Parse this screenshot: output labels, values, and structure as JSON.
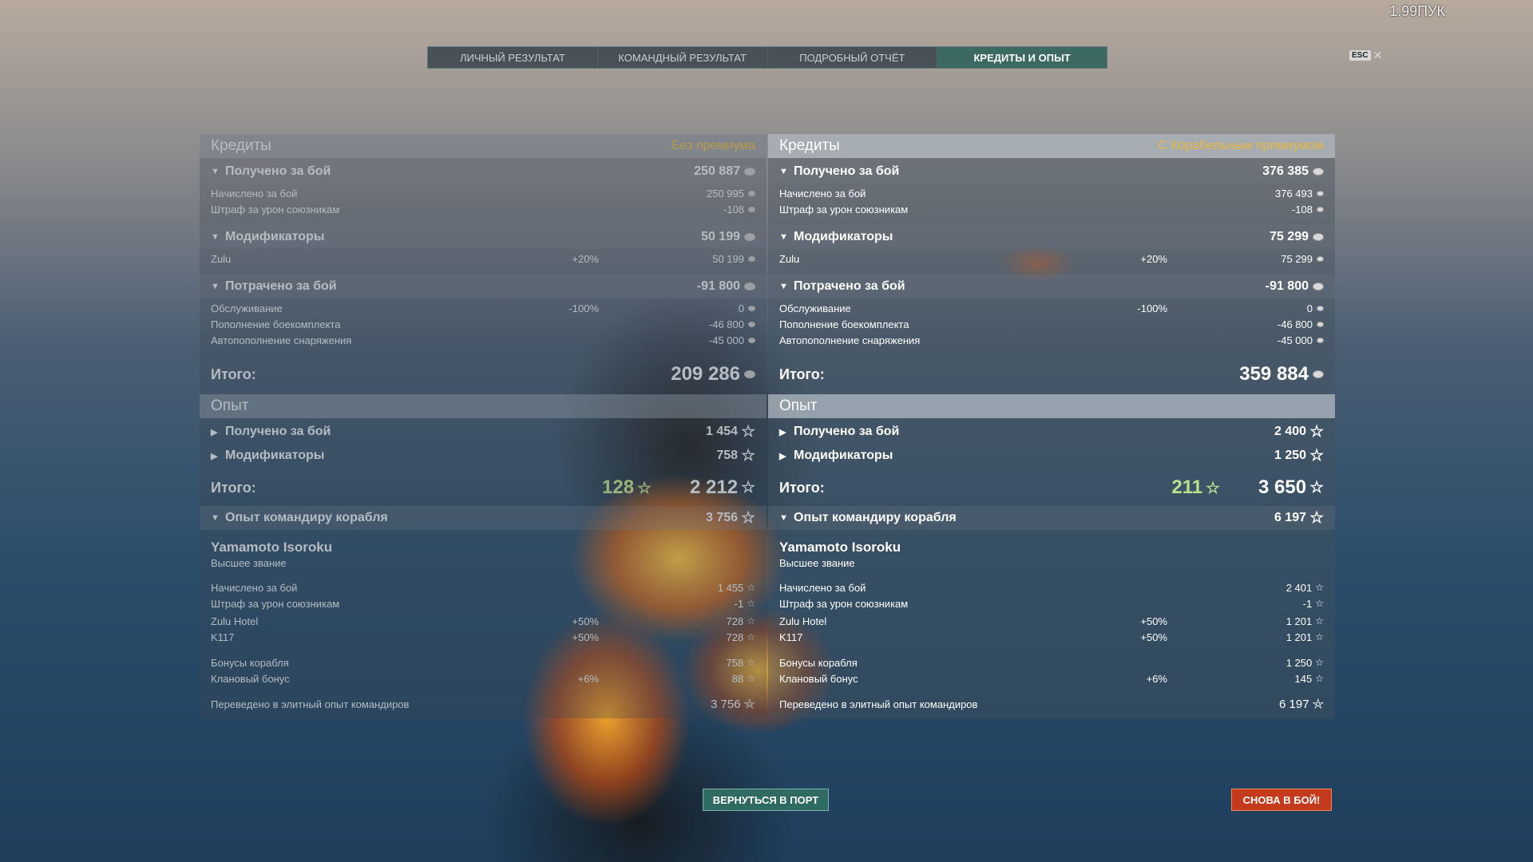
{
  "fps": "1.99ПУК",
  "tabs": [
    "ЛИЧНЫЙ РЕЗУЛЬТАТ",
    "КОМАНДНЫЙ РЕЗУЛЬТАТ",
    "ПОДРОБНЫЙ ОТЧЁТ",
    "КРЕДИТЫ И ОПЫТ"
  ],
  "active_tab": "КРЕДИТЫ И ОПЫТ",
  "esc": {
    "key": "ESC",
    "close": "✕"
  },
  "labels": {
    "credits": "Кредиты",
    "earned": "Получено за бой",
    "accrued": "Начислено за бой",
    "penalty": "Штраф за урон союзникам",
    "modifiers": "Модификаторы",
    "zulu": "Zulu",
    "spent": "Потрачено за бой",
    "service": "Обслуживание",
    "ammo": "Пополнение боекомплекта",
    "supplies": "Автопополнение снаряжения",
    "total": "Итого:",
    "experience": "Опыт",
    "cmd_exp": "Опыт командиру корабля",
    "commander": "Yamamoto Isoroku",
    "rank": "Высшее звание",
    "zulu_hotel": "Zulu Hotel",
    "k117": "K117",
    "ship_bonus": "Бонусы корабля",
    "clan_bonus": "Клановый бонус",
    "elite": "Переведено в элитный опыт командиров"
  },
  "left": {
    "premium_label": "Без премиума",
    "earned": "250 887",
    "accrued": "250 995",
    "penalty": "-108",
    "mods": "50 199",
    "zulu_pct": "+20%",
    "zulu": "50 199",
    "spent": "-91 800",
    "service_pct": "-100%",
    "service": "0",
    "ammo": "-46 800",
    "supplies": "-45 000",
    "credit_total": "209 286",
    "exp_earned": "1 454",
    "exp_mods": "758",
    "free_exp": "128",
    "exp_total": "2 212",
    "cmd_exp": "3 756",
    "cmd_accrued": "1 455",
    "cmd_penalty": "-1",
    "zh_pct": "+50%",
    "zh": "728",
    "k117_pct": "+50%",
    "k117": "728",
    "ship_bonus": "758",
    "clan_pct": "+6%",
    "clan": "88",
    "elite": "3 756"
  },
  "right": {
    "premium_label": "С Корабельным премиумом",
    "earned": "376 385",
    "accrued": "376 493",
    "penalty": "-108",
    "mods": "75 299",
    "zulu_pct": "+20%",
    "zulu": "75 299",
    "spent": "-91 800",
    "service_pct": "-100%",
    "service": "0",
    "ammo": "-46 800",
    "supplies": "-45 000",
    "credit_total": "359 884",
    "exp_earned": "2 400",
    "exp_mods": "1 250",
    "free_exp": "211",
    "exp_total": "3 650",
    "cmd_exp": "6 197",
    "cmd_accrued": "2 401",
    "cmd_penalty": "-1",
    "zh_pct": "+50%",
    "zh": "1 201",
    "k117_pct": "+50%",
    "k117": "1 201",
    "ship_bonus": "1 250",
    "clan_pct": "+6%",
    "clan": "145",
    "elite": "6 197"
  },
  "buttons": {
    "port": "ВЕРНУТЬСЯ В ПОРТ",
    "battle": "СНОВА В БОЙ!"
  },
  "icons": {
    "credit": "credit-coin-icon",
    "xp": "star-icon",
    "elite": "commander-elite-icon"
  },
  "colors": {
    "active_tab": "#3c6a63",
    "premium": "#e9b740",
    "free_exp": "#b8e08a",
    "battle_button": "#c43a1c",
    "port_button": "#2f6b62"
  }
}
